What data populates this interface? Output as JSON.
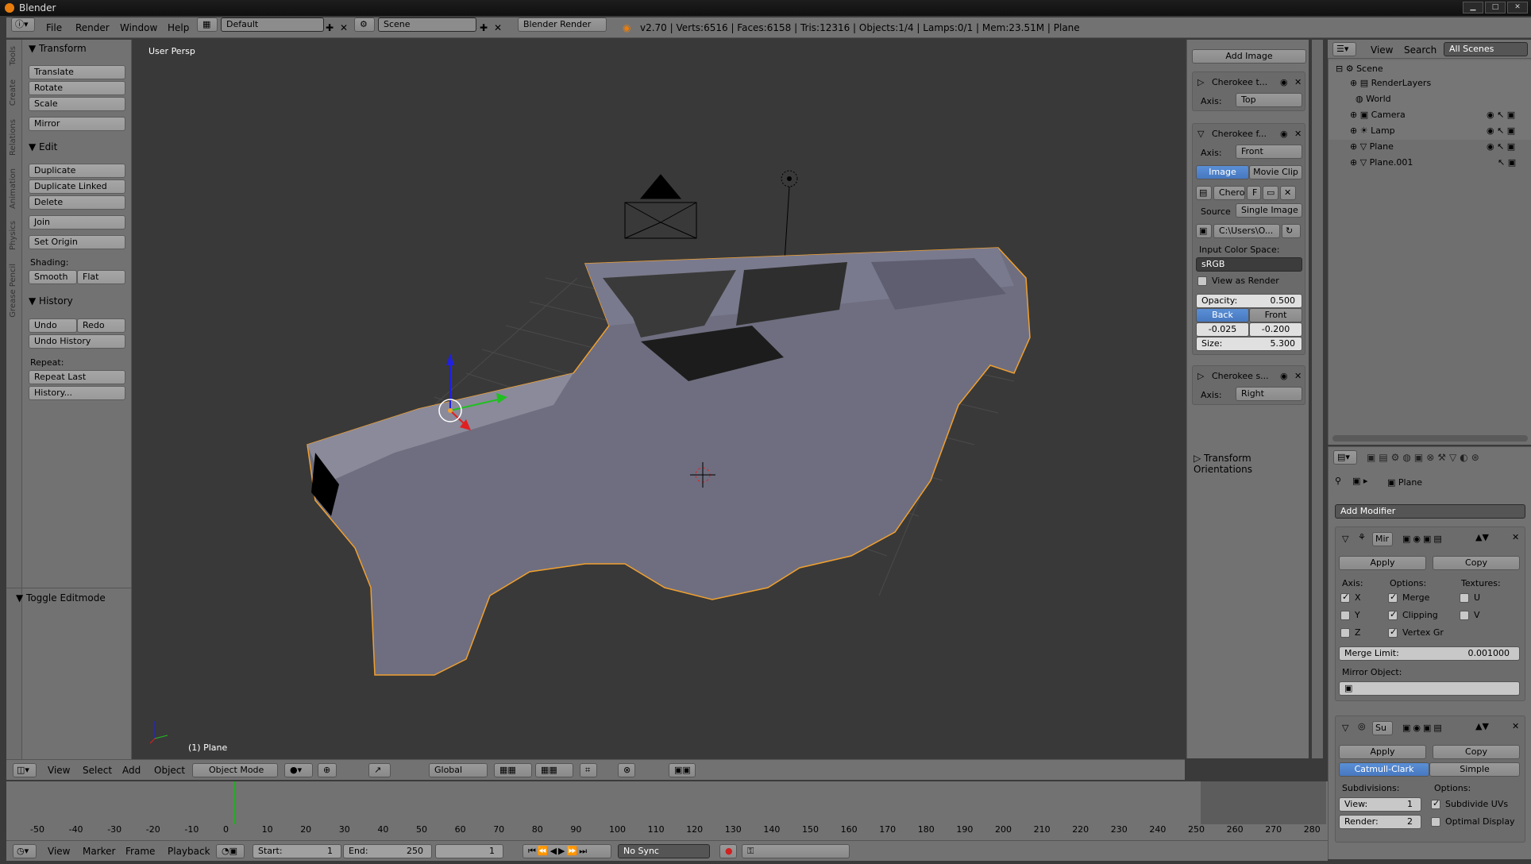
{
  "window": {
    "title": "Blender"
  },
  "menubar": {
    "items": [
      "File",
      "Render",
      "Window",
      "Help"
    ],
    "layout": "Default",
    "scene": "Scene",
    "engine": "Blender Render",
    "stats": "v2.70 | Verts:6516 | Faces:6158 | Tris:12316 | Objects:1/4 | Lamps:0/1 | Mem:23.51M | Plane"
  },
  "tool_tabs": [
    "Tools",
    "Create",
    "Relations",
    "Animation",
    "Physics",
    "Grease Pencil"
  ],
  "toolshelf": {
    "transform_title": "Transform",
    "transform_buttons": [
      "Translate",
      "Rotate",
      "Scale"
    ],
    "mirror": "Mirror",
    "edit_title": "Edit",
    "edit_buttons": [
      "Duplicate",
      "Duplicate Linked",
      "Delete"
    ],
    "join": "Join",
    "set_origin": "Set Origin",
    "shading_label": "Shading:",
    "smooth": "Smooth",
    "flat": "Flat",
    "history_title": "History",
    "undo": "Undo",
    "redo": "Redo",
    "undo_history": "Undo History",
    "repeat_label": "Repeat:",
    "repeat_last": "Repeat Last",
    "history_btn": "History...",
    "operator_title": "Toggle Editmode"
  },
  "viewport": {
    "view_label": "User Persp",
    "object_label": "(1) Plane",
    "mesh_color": "#6e6e80",
    "selection_color": "#f0a030"
  },
  "viewport_header": {
    "menus": [
      "View",
      "Select",
      "Add",
      "Object"
    ],
    "mode": "Object Mode",
    "orientation": "Global"
  },
  "npanel": {
    "add_image": "Add Image",
    "bg1": {
      "name": "Cherokee t...",
      "axis_label": "Axis:",
      "axis": "Top"
    },
    "bg2": {
      "name": "Cherokee f...",
      "axis_label": "Axis:",
      "axis": "Front",
      "tab_image": "Image",
      "tab_movie": "Movie Clip",
      "image_name": "Chero",
      "image_flag": "F",
      "source_label": "Source",
      "source": "Single Image",
      "path": "C:\\Users\\O...",
      "color_space_label": "Input Color Space:",
      "color_space": "sRGB",
      "view_as_render": "View as Render",
      "opacity_label": "Opacity:",
      "opacity": "0.500",
      "back": "Back",
      "front": "Front",
      "x": "-0.025",
      "y": "-0.200",
      "size_label": "Size:",
      "size": "5.300"
    },
    "bg3": {
      "name": "Cherokee s...",
      "axis_label": "Axis:",
      "axis": "Right"
    },
    "transform_orient": "Transform Orientations"
  },
  "outliner": {
    "menus": [
      "View",
      "Search"
    ],
    "filter": "All Scenes",
    "items": [
      {
        "label": "Scene",
        "indent": 0
      },
      {
        "label": "RenderLayers",
        "indent": 1
      },
      {
        "label": "World",
        "indent": 1
      },
      {
        "label": "Camera",
        "indent": 1
      },
      {
        "label": "Lamp",
        "indent": 1
      },
      {
        "label": "Plane",
        "indent": 1
      },
      {
        "label": "Plane.001",
        "indent": 1
      }
    ]
  },
  "properties": {
    "object_name": "Plane",
    "add_modifier": "Add Modifier",
    "mirror": {
      "name": "Mir",
      "apply": "Apply",
      "copy": "Copy",
      "axis_label": "Axis:",
      "options_label": "Options:",
      "textures_label": "Textures:",
      "axes": [
        "X",
        "Y",
        "Z"
      ],
      "axes_checked": [
        true,
        false,
        false
      ],
      "options": [
        "Merge",
        "Clipping",
        "Vertex Gr"
      ],
      "options_checked": [
        true,
        true,
        true
      ],
      "textures": [
        "U",
        "V"
      ],
      "merge_limit_label": "Merge Limit:",
      "merge_limit": "0.001000",
      "mirror_object_label": "Mirror Object:"
    },
    "subsurf": {
      "name": "Su",
      "apply": "Apply",
      "copy": "Copy",
      "catmull": "Catmull-Clark",
      "simple": "Simple",
      "subdivisions_label": "Subdivisions:",
      "options_label": "Options:",
      "view_label": "View:",
      "view": "1",
      "render_label": "Render:",
      "render": "2",
      "subdivide_uvs": "Subdivide UVs",
      "optimal_display": "Optimal Display"
    }
  },
  "timeline": {
    "ticks": [
      "-50",
      "-40",
      "-30",
      "-20",
      "-10",
      "0",
      "10",
      "20",
      "30",
      "40",
      "50",
      "60",
      "70",
      "80",
      "90",
      "100",
      "110",
      "120",
      "130",
      "140",
      "150",
      "160",
      "170",
      "180",
      "190",
      "200",
      "210",
      "220",
      "230",
      "240",
      "250",
      "260",
      "270",
      "280"
    ],
    "menus": [
      "View",
      "Marker",
      "Frame",
      "Playback"
    ],
    "start_label": "Start:",
    "start": "1",
    "end_label": "End:",
    "end": "250",
    "current": "1",
    "sync": "No Sync"
  }
}
